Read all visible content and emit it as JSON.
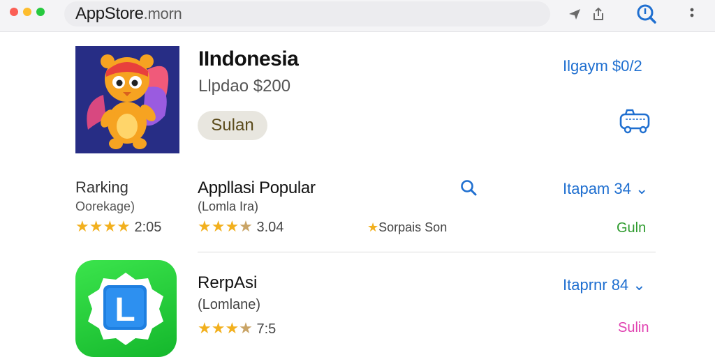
{
  "browser": {
    "url_main": "AppStore",
    "url_suffix": ".morn"
  },
  "featured": {
    "title": "IIndonesia",
    "subtitle": "Llpdao $200",
    "button_label": "Sulan",
    "price_label": "Ilgaym $0/2"
  },
  "ranking": {
    "label": "Rarking",
    "sublabel": "Oorekage)",
    "stars": "★★★★",
    "score": "2:05"
  },
  "popular": {
    "title": "Appllasi Popular",
    "subtitle": "(Lomla Ira)",
    "stars": "★★★",
    "half_star": "★",
    "score": "3.04",
    "sponsor_star": "★",
    "sponsor_label": "Sorpais Son",
    "price_label": "Itapam 34",
    "get_label": "Guln",
    "chevron": "⌄"
  },
  "app2": {
    "title": "RerpAsi",
    "subtitle": "(Lomlane)",
    "stars": "★★★",
    "half_star": "★",
    "score": "7:5",
    "price_label": "Itaprnr 84",
    "get_label": "Sulin",
    "chevron": "⌄",
    "icon_letter": "L"
  },
  "colors": {
    "accent_blue": "#1f6fd0",
    "star_gold": "#f2b01e",
    "get_green": "#2e9b2e",
    "get_pink": "#e040b0"
  }
}
